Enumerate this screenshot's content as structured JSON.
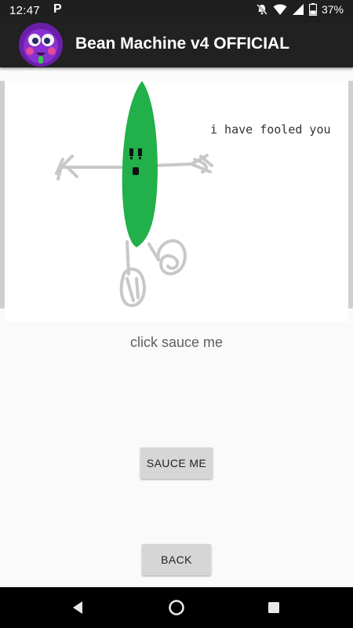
{
  "status_bar": {
    "time": "12:47",
    "notification_letter": "P",
    "battery": "37%"
  },
  "app_bar": {
    "title": "Bean Machine v4 OFFICIAL",
    "avatar_icon": "purple-face-avatar"
  },
  "image": {
    "speech_text": "i have fooled you",
    "bean_color": "#22b04a",
    "stroke_color": "#c8c8c8"
  },
  "caption": "click sauce me",
  "buttons": {
    "sauce": "SAUCE ME",
    "back": "BACK"
  },
  "nav": {
    "back_icon": "triangle-back-icon",
    "home_icon": "circle-home-icon",
    "recents_icon": "square-recents-icon"
  }
}
